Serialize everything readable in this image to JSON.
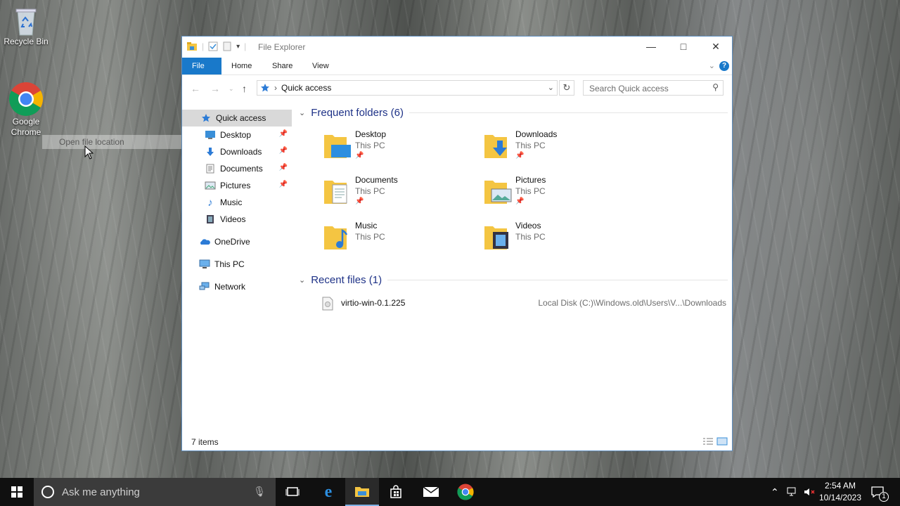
{
  "desktop": {
    "icons": [
      {
        "label": "Recycle Bin"
      },
      {
        "label": "Google Chrome"
      }
    ],
    "drag_ghost": "Open file location"
  },
  "explorer": {
    "title": "File Explorer",
    "ribbon_tabs": [
      "File",
      "Home",
      "Share",
      "View"
    ],
    "help": "?",
    "address": {
      "crumb": "Quick access"
    },
    "search": {
      "placeholder": "Search Quick access"
    },
    "nav_pane": [
      {
        "label": "Quick access",
        "icon": "star-icon",
        "selected": true
      },
      {
        "label": "Desktop",
        "icon": "desktop-folder-icon",
        "pinned": true
      },
      {
        "label": "Downloads",
        "icon": "downloads-folder-icon",
        "pinned": true
      },
      {
        "label": "Documents",
        "icon": "documents-folder-icon",
        "pinned": true
      },
      {
        "label": "Pictures",
        "icon": "pictures-folder-icon",
        "pinned": true
      },
      {
        "label": "Music",
        "icon": "music-folder-icon"
      },
      {
        "label": "Videos",
        "icon": "videos-folder-icon"
      },
      {
        "label": "OneDrive",
        "icon": "onedrive-icon"
      },
      {
        "label": "This PC",
        "icon": "this-pc-icon"
      },
      {
        "label": "Network",
        "icon": "network-icon"
      }
    ],
    "frequent": {
      "header": "Frequent folders (6)",
      "folders": [
        {
          "name": "Desktop",
          "location": "This PC",
          "pinned": true
        },
        {
          "name": "Downloads",
          "location": "This PC",
          "pinned": true
        },
        {
          "name": "Documents",
          "location": "This PC",
          "pinned": true
        },
        {
          "name": "Pictures",
          "location": "This PC",
          "pinned": true
        },
        {
          "name": "Music",
          "location": "This PC",
          "pinned": false
        },
        {
          "name": "Videos",
          "location": "This PC",
          "pinned": false
        }
      ]
    },
    "recent": {
      "header": "Recent files (1)",
      "files": [
        {
          "name": "virtio-win-0.1.225",
          "location": "Local Disk (C:)\\Windows.old\\Users\\V...\\Downloads"
        }
      ]
    },
    "status": {
      "count": "7 items"
    }
  },
  "taskbar": {
    "search_placeholder": "Ask me anything",
    "clock": {
      "time": "2:54 AM",
      "date": "10/14/2023"
    },
    "notifications": "1"
  },
  "colors": {
    "accent": "#1979ca",
    "header_text": "#1e3287",
    "taskbar": "#101010"
  }
}
